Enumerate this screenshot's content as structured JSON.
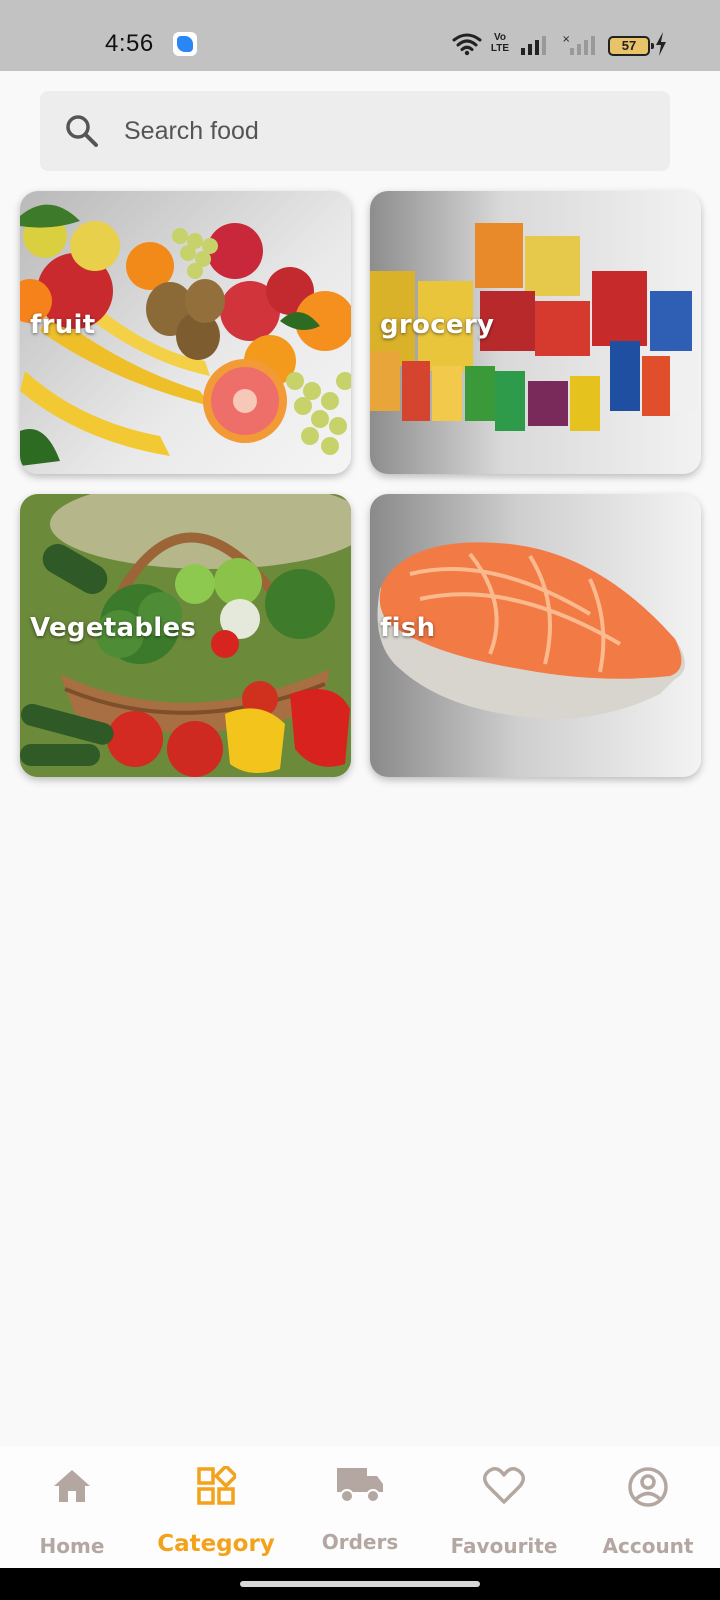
{
  "status_bar": {
    "time": "4:56",
    "network_label": "Vo LTE",
    "battery_level": "57",
    "icons": [
      "app-notification-icon",
      "wifi-icon",
      "signal-icon",
      "signal-no-service-icon",
      "battery-icon",
      "charging-icon"
    ]
  },
  "search": {
    "placeholder": "Search food",
    "value": ""
  },
  "categories": [
    {
      "label": "fruit"
    },
    {
      "label": "grocery"
    },
    {
      "label": "Vegetables"
    },
    {
      "label": "fish"
    }
  ],
  "bottom_nav": {
    "active": "Category",
    "items": [
      {
        "label": "Home",
        "icon": "home-icon"
      },
      {
        "label": "Category",
        "icon": "category-icon"
      },
      {
        "label": "Orders",
        "icon": "truck-icon"
      },
      {
        "label": "Favourite",
        "icon": "heart-icon"
      },
      {
        "label": "Account",
        "icon": "account-icon"
      }
    ]
  },
  "colors": {
    "accent": "#f3a21b",
    "nav_inactive": "#b4a7a2",
    "status_bar": "#c2c2c2",
    "background": "#f9f9f9"
  }
}
